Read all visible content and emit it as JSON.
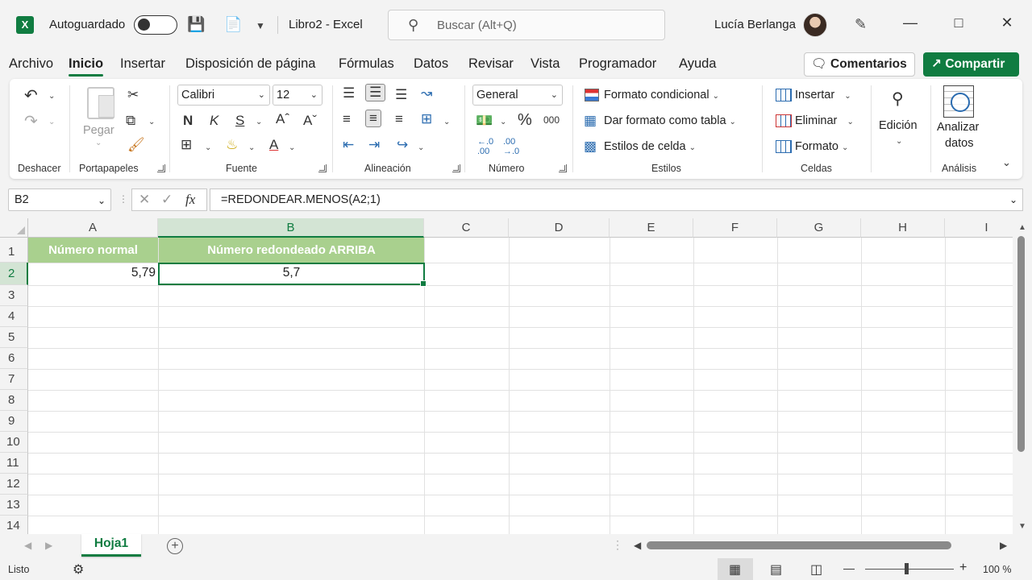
{
  "titlebar": {
    "app_logo": "X",
    "autosave_label": "Autoguardado",
    "document_title": "Libro2  -  Excel",
    "search_placeholder": "Buscar (Alt+Q)",
    "user_name": "Lucía Berlanga"
  },
  "menu": {
    "tabs": [
      "Archivo",
      "Inicio",
      "Insertar",
      "Disposición de página",
      "Fórmulas",
      "Datos",
      "Revisar",
      "Vista",
      "Programador",
      "Ayuda"
    ],
    "active_tab": "Inicio",
    "comments_label": "Comentarios",
    "share_label": "Compartir"
  },
  "ribbon": {
    "groups": {
      "undo": "Deshacer",
      "clipboard": "Portapapeles",
      "font": "Fuente",
      "alignment": "Alineación",
      "number": "Número",
      "styles": "Estilos",
      "cells": "Celdas",
      "analysis": "Análisis"
    },
    "paste_label": "Pegar",
    "font_name": "Calibri",
    "font_size": "12",
    "bold": "N",
    "italic": "K",
    "underline": "S",
    "number_format": "General",
    "percent": "%",
    "thousands": "000",
    "conditional_format": "Formato condicional",
    "format_as_table": "Dar formato como tabla",
    "cell_styles": "Estilos de celda",
    "insert": "Insertar",
    "delete": "Eliminar",
    "format": "Formato",
    "edit": "Edición",
    "analyze_line1": "Analizar",
    "analyze_line2": "datos"
  },
  "formula_bar": {
    "name_box": "B2",
    "fx_label": "fx",
    "formula": "=REDONDEAR.MENOS(A2;1)"
  },
  "sheet": {
    "columns": [
      "A",
      "B",
      "C",
      "D",
      "E",
      "F",
      "G",
      "H",
      "I"
    ],
    "selected_column": "B",
    "rows": [
      "1",
      "2",
      "3",
      "4",
      "5",
      "6",
      "7",
      "8",
      "9",
      "10",
      "11",
      "12",
      "13",
      "14"
    ],
    "selected_row": "2",
    "header_A1": "Número normal",
    "header_B1": "Número redondeado ARRIBA",
    "value_A2": "5,79",
    "value_B2": "5,7",
    "header_fill": "#a9d08e",
    "accent": "#107c41"
  },
  "sheet_tabs": {
    "active": "Hoja1"
  },
  "statusbar": {
    "status": "Listo",
    "zoom": "100 %"
  }
}
